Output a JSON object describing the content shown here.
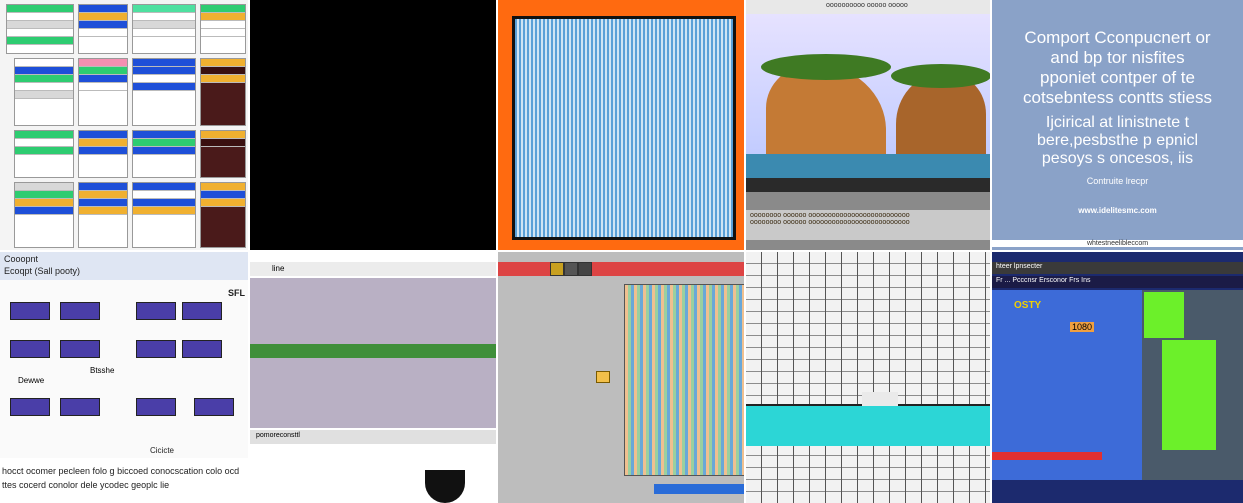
{
  "tiles": {
    "t5": {
      "title_line1": "Comport Cconpucnert or",
      "title_line2": "and bp tor nisfites",
      "title_line3": "pponiet contper of te",
      "title_line4": "cotsebntess contts stiess",
      "body_line1": "Ijcirical at linistnete t",
      "body_line2": "bere,pesbsthe p epnicl",
      "body_line3": "pesoys s oncesos, iis",
      "small": "Contruite lrecpr",
      "url": "www.idelitesmc.com",
      "footer": "whtestneelibleccom"
    },
    "t6": {
      "header_line1": "Cooopnt",
      "header_line2": "Ecoqpt (Sall pooty)",
      "header_right": "SFL",
      "label_left": "Dewwe",
      "label_center": "Btsshe",
      "footer_right": "Cicicte",
      "caption_line1": "hocct ocomer pecleen folo g biccoed conocscation colo ocd",
      "caption_line2": "ttes cocerd conolor dele ycodec geoplc lie"
    },
    "t7": {
      "toolbar": "line",
      "status": "pomoreconsttl"
    },
    "t4": {
      "topbar": "oooooooooo ooooo ooooo",
      "note_line1": "oooooooo oooooo oooooooooooooooooooooooooo",
      "note_line2": "oooooooo oooooo oooooooooooooooooooooooooo"
    },
    "t10": {
      "top": "hteer lpnsecter",
      "sub": "Fr ... Pcccnsr Ersconor Frs Ins",
      "label": "OSTY",
      "code": "1080"
    }
  },
  "colors": {
    "orange_frame": "#ff6a10",
    "cyan_band": "#2cd6d6",
    "green_box": "#6cf02a",
    "blue_board": "#3d6bd8"
  }
}
